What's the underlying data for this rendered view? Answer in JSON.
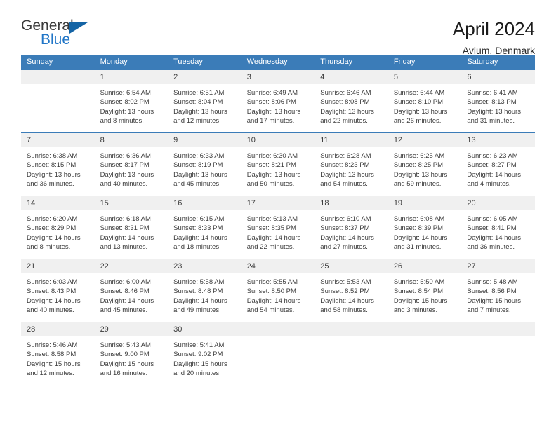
{
  "logo": {
    "word_top": "General",
    "word_bottom": "Blue",
    "triangle_color": "#1464a5",
    "blue_color": "#2176c7"
  },
  "header": {
    "title": "April 2024",
    "subtitle": "Avlum, Denmark"
  },
  "theme": {
    "header_blue": "#3b7cb8",
    "daynum_band": "#f0f0f0",
    "text": "#3b3b3b"
  },
  "weekday_headers": [
    "Sunday",
    "Monday",
    "Tuesday",
    "Wednesday",
    "Thursday",
    "Friday",
    "Saturday"
  ],
  "weeks": [
    [
      {
        "day": "",
        "sunrise": "",
        "sunset": "",
        "daylight_1": "",
        "daylight_2": ""
      },
      {
        "day": "1",
        "sunrise": "Sunrise: 6:54 AM",
        "sunset": "Sunset: 8:02 PM",
        "daylight_1": "Daylight: 13 hours",
        "daylight_2": "and 8 minutes."
      },
      {
        "day": "2",
        "sunrise": "Sunrise: 6:51 AM",
        "sunset": "Sunset: 8:04 PM",
        "daylight_1": "Daylight: 13 hours",
        "daylight_2": "and 12 minutes."
      },
      {
        "day": "3",
        "sunrise": "Sunrise: 6:49 AM",
        "sunset": "Sunset: 8:06 PM",
        "daylight_1": "Daylight: 13 hours",
        "daylight_2": "and 17 minutes."
      },
      {
        "day": "4",
        "sunrise": "Sunrise: 6:46 AM",
        "sunset": "Sunset: 8:08 PM",
        "daylight_1": "Daylight: 13 hours",
        "daylight_2": "and 22 minutes."
      },
      {
        "day": "5",
        "sunrise": "Sunrise: 6:44 AM",
        "sunset": "Sunset: 8:10 PM",
        "daylight_1": "Daylight: 13 hours",
        "daylight_2": "and 26 minutes."
      },
      {
        "day": "6",
        "sunrise": "Sunrise: 6:41 AM",
        "sunset": "Sunset: 8:13 PM",
        "daylight_1": "Daylight: 13 hours",
        "daylight_2": "and 31 minutes."
      }
    ],
    [
      {
        "day": "7",
        "sunrise": "Sunrise: 6:38 AM",
        "sunset": "Sunset: 8:15 PM",
        "daylight_1": "Daylight: 13 hours",
        "daylight_2": "and 36 minutes."
      },
      {
        "day": "8",
        "sunrise": "Sunrise: 6:36 AM",
        "sunset": "Sunset: 8:17 PM",
        "daylight_1": "Daylight: 13 hours",
        "daylight_2": "and 40 minutes."
      },
      {
        "day": "9",
        "sunrise": "Sunrise: 6:33 AM",
        "sunset": "Sunset: 8:19 PM",
        "daylight_1": "Daylight: 13 hours",
        "daylight_2": "and 45 minutes."
      },
      {
        "day": "10",
        "sunrise": "Sunrise: 6:30 AM",
        "sunset": "Sunset: 8:21 PM",
        "daylight_1": "Daylight: 13 hours",
        "daylight_2": "and 50 minutes."
      },
      {
        "day": "11",
        "sunrise": "Sunrise: 6:28 AM",
        "sunset": "Sunset: 8:23 PM",
        "daylight_1": "Daylight: 13 hours",
        "daylight_2": "and 54 minutes."
      },
      {
        "day": "12",
        "sunrise": "Sunrise: 6:25 AM",
        "sunset": "Sunset: 8:25 PM",
        "daylight_1": "Daylight: 13 hours",
        "daylight_2": "and 59 minutes."
      },
      {
        "day": "13",
        "sunrise": "Sunrise: 6:23 AM",
        "sunset": "Sunset: 8:27 PM",
        "daylight_1": "Daylight: 14 hours",
        "daylight_2": "and 4 minutes."
      }
    ],
    [
      {
        "day": "14",
        "sunrise": "Sunrise: 6:20 AM",
        "sunset": "Sunset: 8:29 PM",
        "daylight_1": "Daylight: 14 hours",
        "daylight_2": "and 8 minutes."
      },
      {
        "day": "15",
        "sunrise": "Sunrise: 6:18 AM",
        "sunset": "Sunset: 8:31 PM",
        "daylight_1": "Daylight: 14 hours",
        "daylight_2": "and 13 minutes."
      },
      {
        "day": "16",
        "sunrise": "Sunrise: 6:15 AM",
        "sunset": "Sunset: 8:33 PM",
        "daylight_1": "Daylight: 14 hours",
        "daylight_2": "and 18 minutes."
      },
      {
        "day": "17",
        "sunrise": "Sunrise: 6:13 AM",
        "sunset": "Sunset: 8:35 PM",
        "daylight_1": "Daylight: 14 hours",
        "daylight_2": "and 22 minutes."
      },
      {
        "day": "18",
        "sunrise": "Sunrise: 6:10 AM",
        "sunset": "Sunset: 8:37 PM",
        "daylight_1": "Daylight: 14 hours",
        "daylight_2": "and 27 minutes."
      },
      {
        "day": "19",
        "sunrise": "Sunrise: 6:08 AM",
        "sunset": "Sunset: 8:39 PM",
        "daylight_1": "Daylight: 14 hours",
        "daylight_2": "and 31 minutes."
      },
      {
        "day": "20",
        "sunrise": "Sunrise: 6:05 AM",
        "sunset": "Sunset: 8:41 PM",
        "daylight_1": "Daylight: 14 hours",
        "daylight_2": "and 36 minutes."
      }
    ],
    [
      {
        "day": "21",
        "sunrise": "Sunrise: 6:03 AM",
        "sunset": "Sunset: 8:43 PM",
        "daylight_1": "Daylight: 14 hours",
        "daylight_2": "and 40 minutes."
      },
      {
        "day": "22",
        "sunrise": "Sunrise: 6:00 AM",
        "sunset": "Sunset: 8:46 PM",
        "daylight_1": "Daylight: 14 hours",
        "daylight_2": "and 45 minutes."
      },
      {
        "day": "23",
        "sunrise": "Sunrise: 5:58 AM",
        "sunset": "Sunset: 8:48 PM",
        "daylight_1": "Daylight: 14 hours",
        "daylight_2": "and 49 minutes."
      },
      {
        "day": "24",
        "sunrise": "Sunrise: 5:55 AM",
        "sunset": "Sunset: 8:50 PM",
        "daylight_1": "Daylight: 14 hours",
        "daylight_2": "and 54 minutes."
      },
      {
        "day": "25",
        "sunrise": "Sunrise: 5:53 AM",
        "sunset": "Sunset: 8:52 PM",
        "daylight_1": "Daylight: 14 hours",
        "daylight_2": "and 58 minutes."
      },
      {
        "day": "26",
        "sunrise": "Sunrise: 5:50 AM",
        "sunset": "Sunset: 8:54 PM",
        "daylight_1": "Daylight: 15 hours",
        "daylight_2": "and 3 minutes."
      },
      {
        "day": "27",
        "sunrise": "Sunrise: 5:48 AM",
        "sunset": "Sunset: 8:56 PM",
        "daylight_1": "Daylight: 15 hours",
        "daylight_2": "and 7 minutes."
      }
    ],
    [
      {
        "day": "28",
        "sunrise": "Sunrise: 5:46 AM",
        "sunset": "Sunset: 8:58 PM",
        "daylight_1": "Daylight: 15 hours",
        "daylight_2": "and 12 minutes."
      },
      {
        "day": "29",
        "sunrise": "Sunrise: 5:43 AM",
        "sunset": "Sunset: 9:00 PM",
        "daylight_1": "Daylight: 15 hours",
        "daylight_2": "and 16 minutes."
      },
      {
        "day": "30",
        "sunrise": "Sunrise: 5:41 AM",
        "sunset": "Sunset: 9:02 PM",
        "daylight_1": "Daylight: 15 hours",
        "daylight_2": "and 20 minutes."
      },
      {
        "day": "",
        "sunrise": "",
        "sunset": "",
        "daylight_1": "",
        "daylight_2": ""
      },
      {
        "day": "",
        "sunrise": "",
        "sunset": "",
        "daylight_1": "",
        "daylight_2": ""
      },
      {
        "day": "",
        "sunrise": "",
        "sunset": "",
        "daylight_1": "",
        "daylight_2": ""
      },
      {
        "day": "",
        "sunrise": "",
        "sunset": "",
        "daylight_1": "",
        "daylight_2": ""
      }
    ]
  ]
}
